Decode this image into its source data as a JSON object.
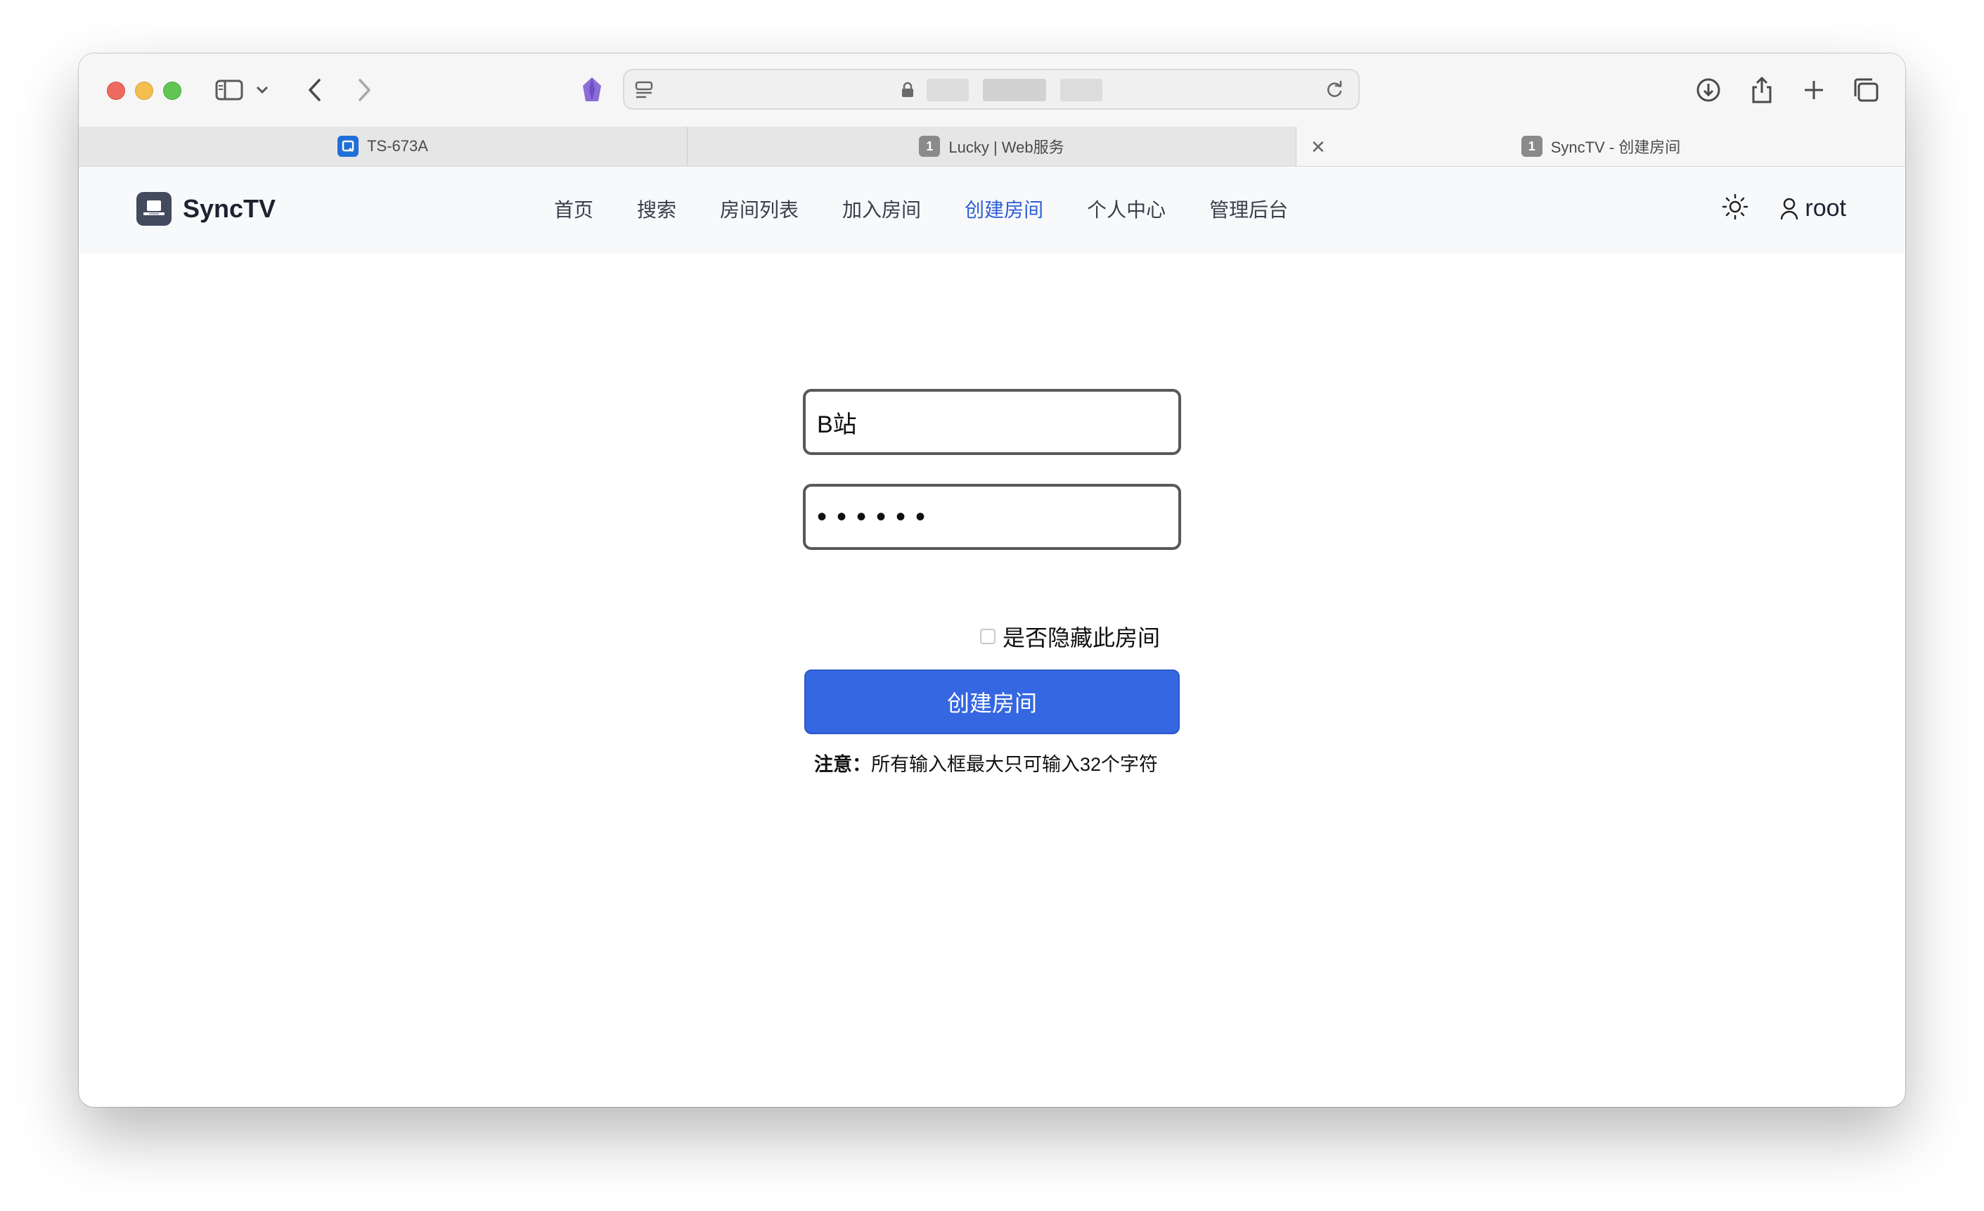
{
  "browser": {
    "url_text": "s",
    "tabs": [
      {
        "label": "TS-673A",
        "favicon": "qnap-icon",
        "active": false
      },
      {
        "label": "Lucky | Web服务",
        "favicon_text": "1",
        "active": false
      },
      {
        "label": "SyncTV - 创建房间",
        "favicon_text": "1",
        "active": true
      }
    ]
  },
  "app": {
    "brand": "SyncTV",
    "nav": [
      "首页",
      "搜索",
      "房间列表",
      "加入房间",
      "创建房间",
      "个人中心",
      "管理后台"
    ],
    "active_nav": "创建房间",
    "user": "root"
  },
  "form": {
    "room_name": "B站",
    "password": "••••••",
    "hide_room_label": "是否隐藏此房间",
    "hide_room_checked": false,
    "submit_label": "创建房间",
    "note_label": "注意：",
    "note_text": "所有输入框最大只可输入32个字符"
  },
  "colors": {
    "accent": "#3567e2",
    "active_nav": "#2f5fd6"
  }
}
